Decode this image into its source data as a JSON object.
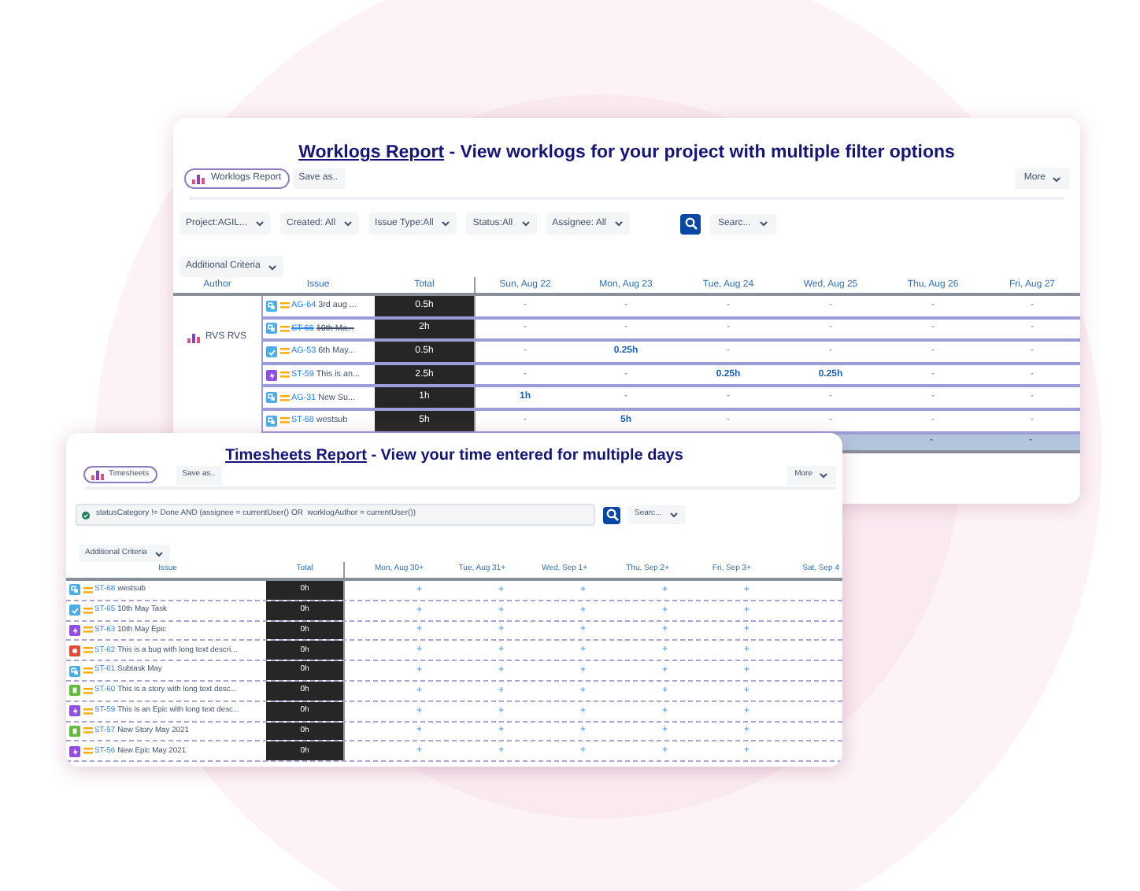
{
  "worklogs": {
    "title_link": "Worklogs Report",
    "title_rest": " - View worklogs for your project with multiple filter options",
    "report_button": "Worklogs Report",
    "save_button": "Save as..",
    "more_button": "More",
    "filters": [
      "Project:AGIL...",
      "Created: All",
      "Issue Type:All",
      "Status:All",
      "Assignee: All"
    ],
    "search_dropdown": "Searc...",
    "additional_criteria": "Additional Criteria",
    "columns": [
      "Author",
      "Issue",
      "Total",
      "Sun, Aug 22",
      "Mon, Aug 23",
      "Tue, Aug 24",
      "Wed, Aug 25",
      "Thu, Aug 26",
      "Fri, Aug 27"
    ],
    "author": "RVS RVS",
    "rows": [
      {
        "key": "AG-64",
        "summary": "3rd aug ...",
        "kind": "subtask",
        "color": "#4bade8",
        "done": false,
        "total": "0.5h",
        "days": [
          "-",
          "-",
          "-",
          "-",
          "-",
          "-"
        ]
      },
      {
        "key": "ST-66",
        "summary": "10th Ma...",
        "kind": "subtask",
        "color": "#4bade8",
        "done": true,
        "total": "2h",
        "days": [
          "-",
          "-",
          "-",
          "-",
          "-",
          "-"
        ]
      },
      {
        "key": "AG-53",
        "summary": "6th May...",
        "kind": "task",
        "color": "#4bade8",
        "done": false,
        "total": "0.5h",
        "days": [
          "-",
          "0.25h",
          "-",
          "-",
          "-",
          "-"
        ]
      },
      {
        "key": "ST-59",
        "summary": "This is an...",
        "kind": "epic",
        "color": "#904ee2",
        "done": false,
        "total": "2.5h",
        "days": [
          "-",
          "-",
          "0.25h",
          "0.25h",
          "-",
          "-"
        ]
      },
      {
        "key": "AG-31",
        "summary": "New Su...",
        "kind": "subtask",
        "color": "#4bade8",
        "done": false,
        "total": "1h",
        "days": [
          "1h",
          "-",
          "-",
          "-",
          "-",
          "-"
        ]
      },
      {
        "key": "ST-68",
        "summary": "westsub",
        "kind": "subtask",
        "color": "#4bade8",
        "done": false,
        "total": "5h",
        "days": [
          "-",
          "5h",
          "-",
          "-",
          "-",
          "-"
        ]
      }
    ],
    "summary_row": [
      "-",
      "-"
    ]
  },
  "timesheets": {
    "title_link": "Timesheets Report",
    "title_rest": " - View your time entered for multiple days",
    "report_button": "Timesheets",
    "save_button": "Save as..",
    "more_button": "More",
    "jql": "statusCategory != Done AND (assignee = currentUser() OR  worklogAuthor = currentUser())",
    "search_dropdown": "Searc...",
    "additional_criteria": "Additional Criteria",
    "columns": [
      "Issue",
      "Total",
      "Mon, Aug 30+",
      "Tue, Aug 31+",
      "Wed, Sep 1+",
      "Thu, Sep 2+",
      "Fri, Sep 3+",
      "Sat, Sep 4"
    ],
    "rows": [
      {
        "key": "ST-68",
        "summary": "westsub",
        "kind": "subtask",
        "color": "#4bade8",
        "total": "0h",
        "days": [
          "+",
          "+",
          "+",
          "+",
          "+"
        ]
      },
      {
        "key": "ST-65",
        "summary": "10th May Task",
        "kind": "task",
        "color": "#4bade8",
        "total": "0h",
        "days": [
          "+",
          "+",
          "+",
          "+",
          "+"
        ]
      },
      {
        "key": "ST-63",
        "summary": "10th May Epic",
        "kind": "epic",
        "color": "#904ee2",
        "total": "0h",
        "days": [
          "+",
          "+",
          "+",
          "+",
          "+"
        ]
      },
      {
        "key": "ST-62",
        "summary": "This is a bug with long text descri...",
        "kind": "bug",
        "color": "#e5493a",
        "total": "0h",
        "days": [
          "+",
          "+",
          "+",
          "+",
          "+"
        ]
      },
      {
        "key": "ST-61",
        "summary": "Subtask May",
        "kind": "subtask",
        "color": "#4bade8",
        "total": "0h",
        "days": [
          "+",
          "+",
          "+",
          "+",
          "+"
        ]
      },
      {
        "key": "ST-60",
        "summary": "This is a story with long text desc...",
        "kind": "story",
        "color": "#63ba3c",
        "total": "0h",
        "days": [
          "+",
          "+",
          "+",
          "+",
          "+"
        ]
      },
      {
        "key": "ST-59",
        "summary": "This is an Epic with long text desc...",
        "kind": "epic",
        "color": "#904ee2",
        "total": "0h",
        "days": [
          "+",
          "+",
          "+",
          "+",
          "+"
        ]
      },
      {
        "key": "ST-57",
        "summary": "New Story May 2021",
        "kind": "story",
        "color": "#63ba3c",
        "total": "0h",
        "days": [
          "+",
          "+",
          "+",
          "+",
          "+"
        ]
      },
      {
        "key": "ST-56",
        "summary": "New Epic May 2021",
        "kind": "epic",
        "color": "#904ee2",
        "total": "0h",
        "days": [
          "+",
          "+",
          "+",
          "+",
          "+"
        ]
      }
    ]
  }
}
